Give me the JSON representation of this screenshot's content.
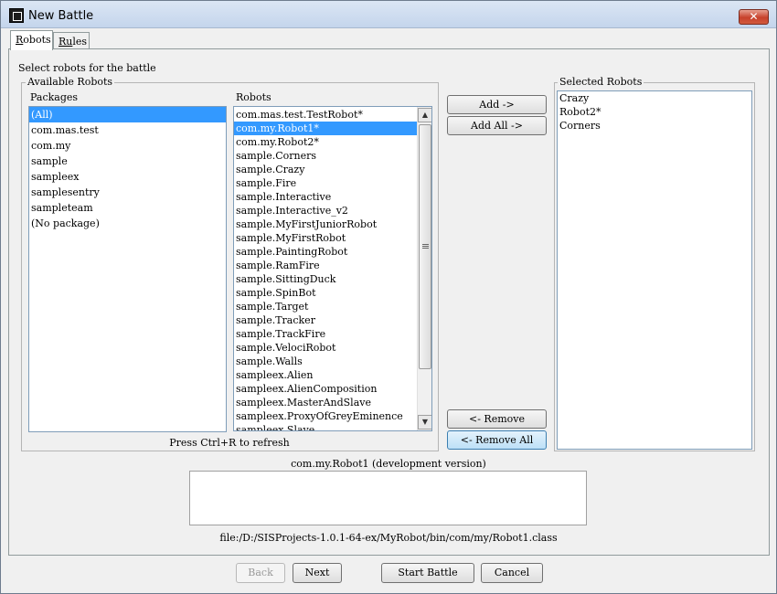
{
  "window": {
    "title": "New Battle",
    "close_glyph": "✕"
  },
  "tabs": [
    {
      "label_first": "R",
      "label_rest": "obots",
      "active": true
    },
    {
      "label_first": "Ru",
      "label_rest": "les",
      "active": false
    }
  ],
  "instruction": "Select robots for the battle",
  "available": {
    "legend": "Available Robots",
    "packages_header": "Packages",
    "robots_header": "Robots",
    "packages": [
      "(All)",
      "com.mas.test",
      "com.my",
      "sample",
      "sampleex",
      "samplesentry",
      "sampleteam",
      "(No package)"
    ],
    "selected_package_index": 0,
    "robots": [
      "com.mas.test.TestRobot*",
      "com.my.Robot1*",
      "com.my.Robot2*",
      "sample.Corners",
      "sample.Crazy",
      "sample.Fire",
      "sample.Interactive",
      "sample.Interactive_v2",
      "sample.MyFirstJuniorRobot",
      "sample.MyFirstRobot",
      "sample.PaintingRobot",
      "sample.RamFire",
      "sample.SittingDuck",
      "sample.SpinBot",
      "sample.Target",
      "sample.Tracker",
      "sample.TrackFire",
      "sample.VelociRobot",
      "sample.Walls",
      "sampleex.Alien",
      "sampleex.AlienComposition",
      "sampleex.MasterAndSlave",
      "sampleex.ProxyOfGreyEminence",
      "sampleex.Slave"
    ],
    "selected_robot_index": 1,
    "refresh_hint": "Press Ctrl+R to refresh"
  },
  "buttons": {
    "add": "Add ->",
    "add_all": "Add All ->",
    "remove": "<- Remove",
    "remove_all": "<- Remove All",
    "back": "Back",
    "next": "Next",
    "start_battle": "Start Battle",
    "cancel": "Cancel"
  },
  "selected": {
    "legend": "Selected Robots",
    "robots": [
      "Crazy",
      "Robot2*",
      "Corners"
    ]
  },
  "details": {
    "robot_title": "com.my.Robot1 (development version)",
    "description": "",
    "file_path": "file:/D:/SISProjects-1.0.1-64-ex/MyRobot/bin/com/my/Robot1.class"
  },
  "icons": {
    "scroll_up": "▲",
    "scroll_down": "▼"
  }
}
